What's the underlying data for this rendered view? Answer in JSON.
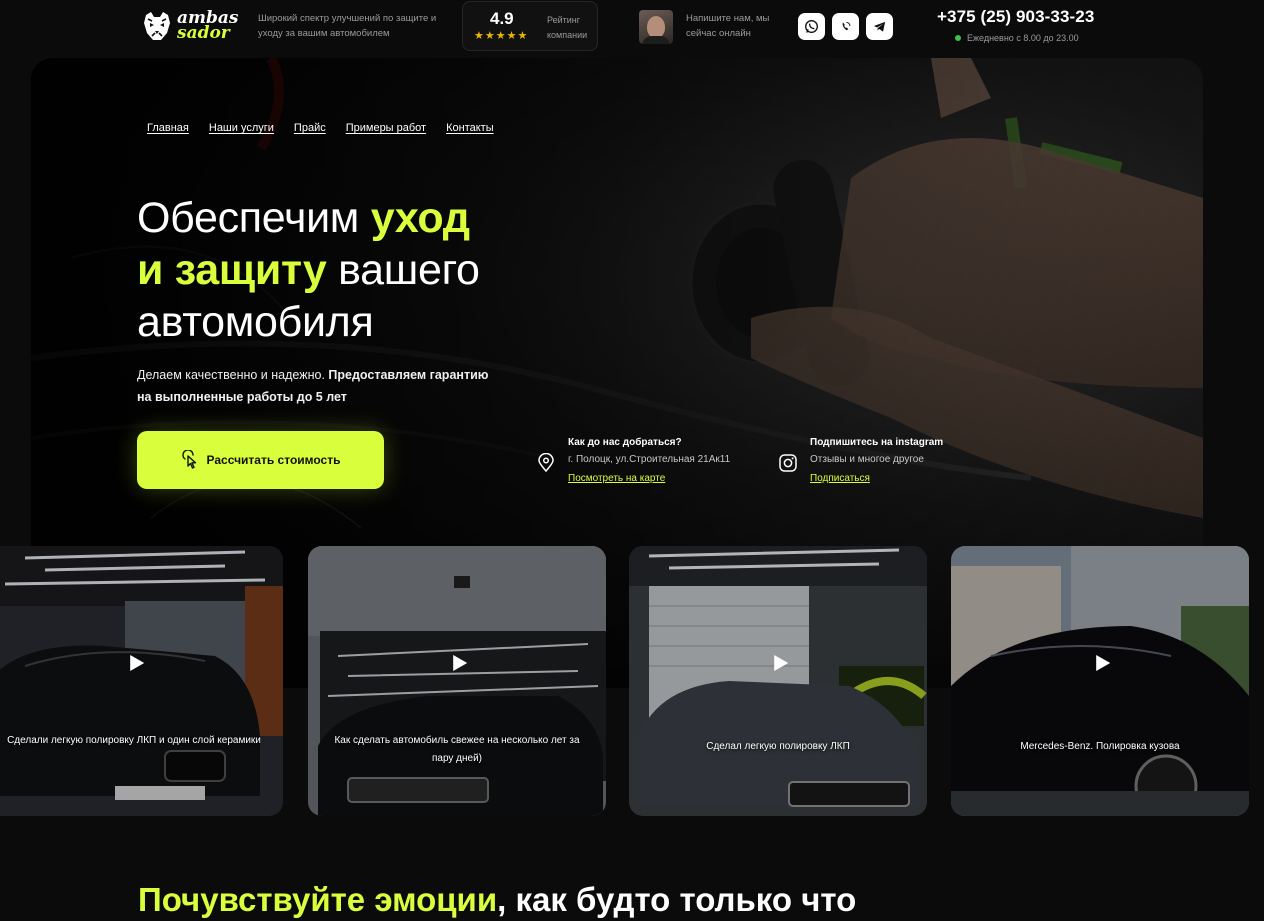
{
  "header": {
    "logo": {
      "line1": "ambas",
      "line2": "sador"
    },
    "tagline": "Широкий спектр улучшений по защите и уходу за вашим автомобилем",
    "rating": {
      "value": "4.9",
      "stars": 5,
      "label": "Рейтинг компании"
    },
    "manager_text": "Напишите нам, мы сейчас онлайн",
    "socials": [
      {
        "icon": "whatsapp-icon"
      },
      {
        "icon": "viber-icon"
      },
      {
        "icon": "telegram-icon"
      }
    ],
    "phone": "+375 (25) 903-33-23",
    "hours": "Ежедневно с 8.00 до 23.00",
    "status_color": "#3fbf4e"
  },
  "nav": [
    {
      "label": "Главная"
    },
    {
      "label": "Наши услуги"
    },
    {
      "label": "Прайс"
    },
    {
      "label": "Примеры работ"
    },
    {
      "label": "Контакты"
    }
  ],
  "hero": {
    "title_part1": "Обеспечим ",
    "title_accent1": "уход",
    "title_accent2": "и защиту",
    "title_part2": " вашего",
    "title_part3": "автомобиля",
    "subtitle_plain": "Делаем качественно и надежно. ",
    "subtitle_bold": "Предоставляем гарантию на выполненные работы до 5 лет",
    "cta_label": "Рассчитать стоимость"
  },
  "location": {
    "title": "Как до нас добраться?",
    "address": "г. Полоцк, ул.Строительная 21Ак11",
    "link": "Посмотреть на карте"
  },
  "instagram": {
    "title": "Подпишитесь на instagram",
    "text": "Отзывы и многое другое",
    "link": "Подписаться"
  },
  "videos": [
    {
      "caption": "Сделали легкую полировку ЛКП и один слой керамики"
    },
    {
      "caption": "Как сделать автомобиль свежее на несколько лет за пару дней)"
    },
    {
      "caption": "Сделал легкую полировку ЛКП"
    },
    {
      "caption": "Mercedes-Benz. Полировка кузова"
    }
  ],
  "section": {
    "heading_accent": "Почувствуйте эмоции",
    "heading_rest": ", как будто только что"
  },
  "colors": {
    "accent": "#d9ff3c",
    "background": "#0b0b0b",
    "star": "#e6b800"
  }
}
